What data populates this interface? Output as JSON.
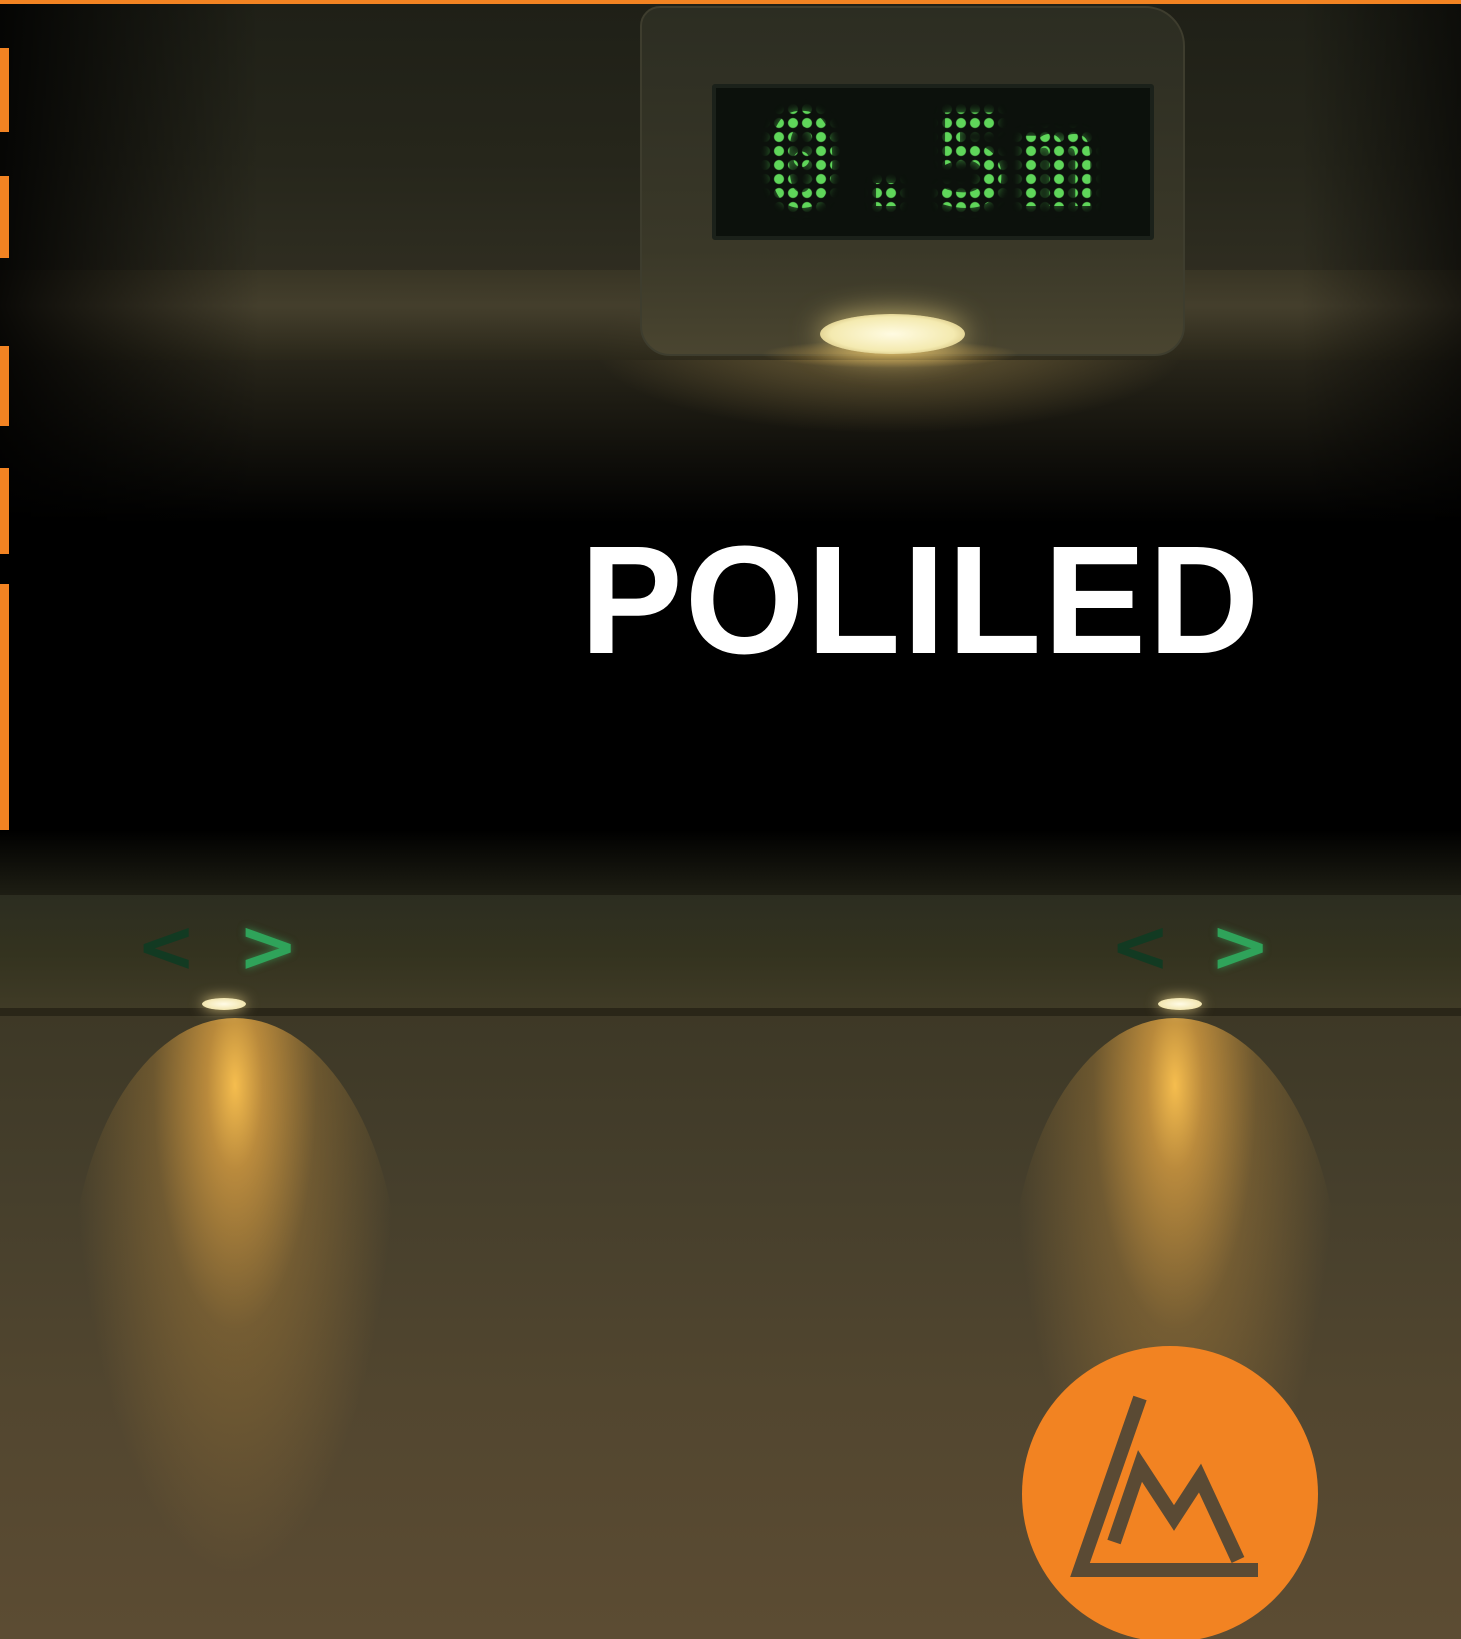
{
  "headline": "POLILED",
  "display": {
    "text": "0.5m",
    "color": "#5fd65a"
  },
  "accent_color": "#f28322",
  "headline_color": "#ffffff",
  "direction_signs": [
    {
      "left_arrow": "<",
      "right_arrow": ">"
    },
    {
      "left_arrow": "<",
      "right_arrow": ">"
    }
  ],
  "logo": {
    "icon": "lm-mountain-logo",
    "background": "#f28322",
    "stroke": "#5a4a34"
  }
}
